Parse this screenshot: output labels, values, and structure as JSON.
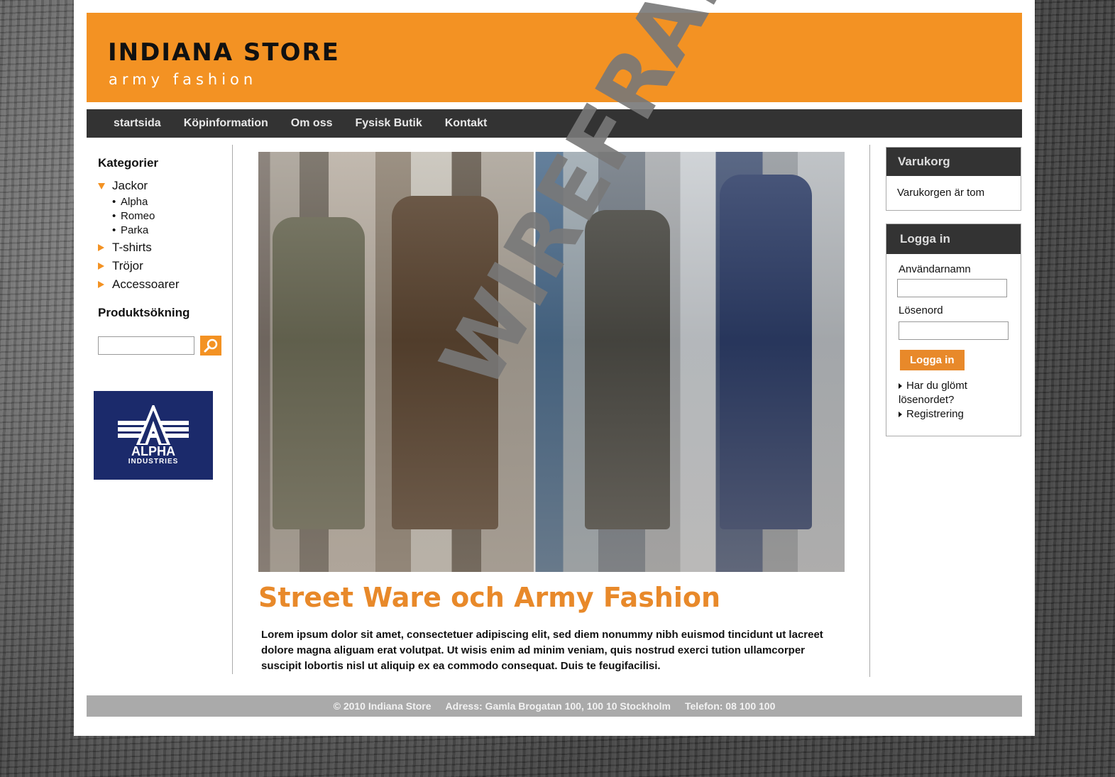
{
  "brand": {
    "name": "INDIANA STORE",
    "tagline": "army fashion",
    "accent_color": "#f39223"
  },
  "nav": {
    "items": [
      "startsida",
      "Köpinformation",
      "Om oss",
      "Fysisk Butik",
      "Kontakt"
    ]
  },
  "sidebar": {
    "categories_title": "Kategorier",
    "categories": [
      {
        "label": "Jackor",
        "expanded": true,
        "children": [
          "Alpha",
          "Romeo",
          "Parka"
        ]
      },
      {
        "label": "T-shirts",
        "expanded": false
      },
      {
        "label": "Tröjor",
        "expanded": false
      },
      {
        "label": "Accessoarer",
        "expanded": false
      }
    ],
    "search_title": "Produktsökning",
    "search_value": "",
    "search_icon": "magnifier-icon",
    "ad_logo": {
      "line1": "ALPHA",
      "line2": "INDUSTRIES",
      "color": "#1b2a6b"
    }
  },
  "main": {
    "title": "Street Ware och Army Fashion",
    "body": "Lorem ipsum dolor sit amet, consectetuer adipiscing elit, sed diem nonummy nibh euismod tincidunt ut lacreet dolore magna aliguam erat volutpat. Ut wisis enim ad minim veniam, quis nostrud exerci tution ullamcorper suscipit lobortis nisl ut aliquip ex ea commodo consequat. Duis te feugifacilisi."
  },
  "cart": {
    "title": "Varukorg",
    "status": "Varukorgen är tom"
  },
  "login": {
    "title": "Logga in",
    "username_label": "Användarnamn",
    "username_value": "",
    "password_label": "Lösenord",
    "password_value": "",
    "button_label": "Logga in",
    "forgot_link": "Har du glömt lösenordet?",
    "register_link": "Registrering"
  },
  "footer": {
    "copyright": "© 2010 Indiana Store",
    "address": "Adress: Gamla Brogatan 100, 100 10 Stockholm",
    "phone": "Telefon: 08 100 100"
  },
  "watermark": "WIREFRAME"
}
